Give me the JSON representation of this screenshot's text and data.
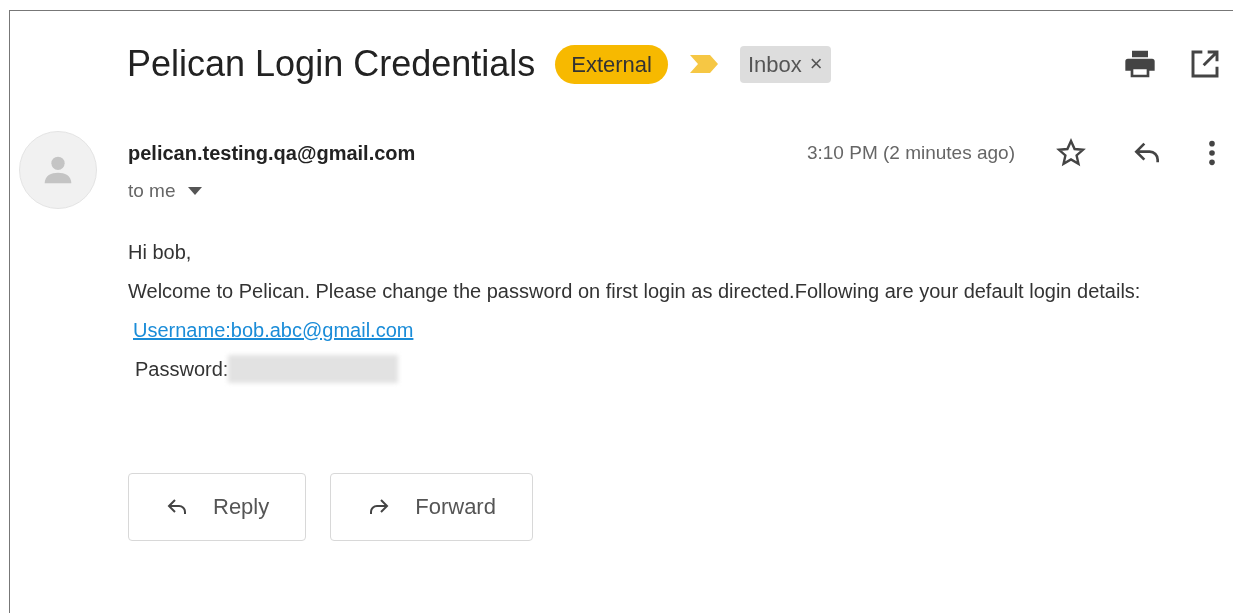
{
  "subject": "Pelican Login Credentials",
  "labels": [
    {
      "text": "External",
      "kind": "external"
    },
    {
      "text": "Inbox",
      "kind": "removable",
      "remove": "×"
    }
  ],
  "sender": {
    "email": "pelican.testing.qa@gmail.com",
    "recipient": "to me",
    "time": "3:10 PM (2 minutes ago)"
  },
  "body": {
    "greeting": "Hi bob,",
    "paragraph": "Welcome to Pelican. Please change the password on first login as directed.Following are your default login details:",
    "username_link": "Username:bob.abc@gmail.com",
    "password_label": "Password:"
  },
  "actions": [
    {
      "label": "Reply",
      "kind": "reply"
    },
    {
      "label": "Forward",
      "kind": "forward"
    }
  ]
}
